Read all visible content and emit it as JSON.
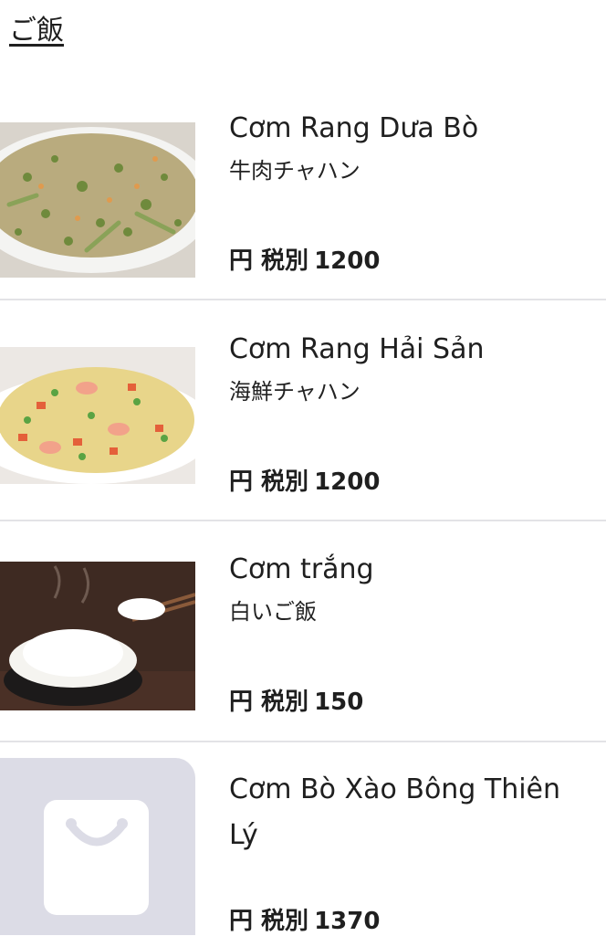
{
  "category": {
    "title": "ご飯"
  },
  "items": [
    {
      "name": "Cơm Rang Dưa Bò",
      "subname": "牛肉チャハン",
      "price_prefix": "円 税別",
      "price": "1200",
      "image": "fried-rice-beef-photo"
    },
    {
      "name": "Cơm Rang Hải Sản",
      "subname": "海鮮チャハン",
      "price_prefix": "円 税別",
      "price": "1200",
      "image": "seafood-fried-rice-photo"
    },
    {
      "name": "Cơm trắng",
      "subname": "白いご飯",
      "price_prefix": "円 税別",
      "price": "150",
      "image": "white-rice-bowl-photo"
    },
    {
      "name": "Cơm Bò Xào Bông Thiên Lý",
      "subname": "",
      "price_prefix": "円 税別",
      "price": "1370",
      "image": "placeholder-bag-icon"
    }
  ],
  "colors": {
    "divider": "#e3e3e6",
    "placeholder_bg": "#dcdce6",
    "text": "#1f1f1f"
  }
}
